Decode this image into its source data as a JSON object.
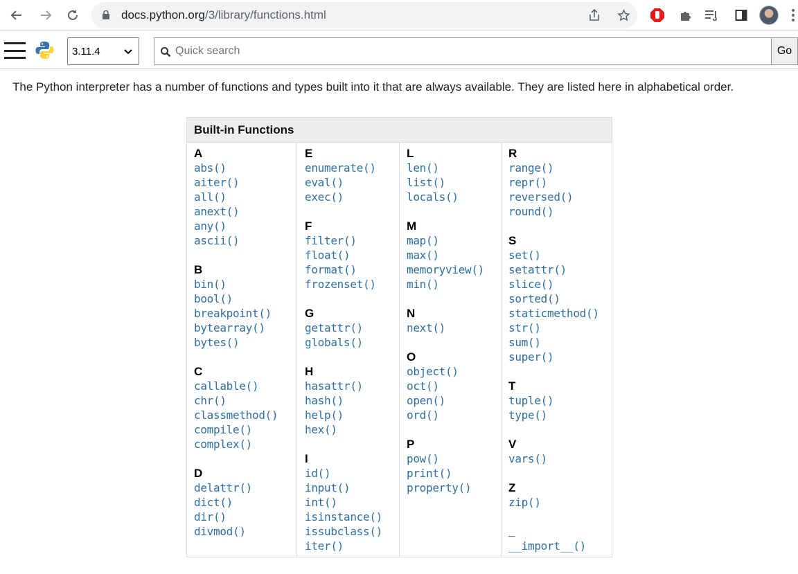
{
  "browser": {
    "url_host": "docs.python.org",
    "url_path": "/3/library/functions.html"
  },
  "docs_nav": {
    "version": "3.11.4",
    "search_placeholder": "Quick search",
    "go_label": "Go"
  },
  "intro": "The Python interpreter has a number of functions and types built into it that are always available. They are listed here in alphabetical order.",
  "table": {
    "header": "Built-in Functions",
    "columns": [
      [
        {
          "letter": "A",
          "items": [
            "abs()",
            "aiter()",
            "all()",
            "anext()",
            "any()",
            "ascii()"
          ]
        },
        {
          "letter": "B",
          "items": [
            "bin()",
            "bool()",
            "breakpoint()",
            "bytearray()",
            "bytes()"
          ]
        },
        {
          "letter": "C",
          "items": [
            "callable()",
            "chr()",
            "classmethod()",
            "compile()",
            "complex()"
          ]
        },
        {
          "letter": "D",
          "items": [
            "delattr()",
            "dict()",
            "dir()",
            "divmod()"
          ]
        }
      ],
      [
        {
          "letter": "E",
          "items": [
            "enumerate()",
            "eval()",
            "exec()"
          ]
        },
        {
          "letter": "F",
          "items": [
            "filter()",
            "float()",
            "format()",
            "frozenset()"
          ]
        },
        {
          "letter": "G",
          "items": [
            "getattr()",
            "globals()"
          ]
        },
        {
          "letter": "H",
          "items": [
            "hasattr()",
            "hash()",
            "help()",
            "hex()"
          ]
        },
        {
          "letter": "I",
          "items": [
            "id()",
            "input()",
            "int()",
            "isinstance()",
            "issubclass()",
            "iter()"
          ]
        }
      ],
      [
        {
          "letter": "L",
          "items": [
            "len()",
            "list()",
            "locals()"
          ]
        },
        {
          "letter": "M",
          "items": [
            "map()",
            "max()",
            "memoryview()",
            "min()"
          ]
        },
        {
          "letter": "N",
          "items": [
            "next()"
          ]
        },
        {
          "letter": "O",
          "items": [
            "object()",
            "oct()",
            "open()",
            "ord()"
          ]
        },
        {
          "letter": "P",
          "items": [
            "pow()",
            "print()",
            "property()"
          ]
        }
      ],
      [
        {
          "letter": "R",
          "items": [
            "range()",
            "repr()",
            "reversed()",
            "round()"
          ]
        },
        {
          "letter": "S",
          "items": [
            "set()",
            "setattr()",
            "slice()",
            "sorted()",
            "staticmethod()",
            "str()",
            "sum()",
            "super()"
          ]
        },
        {
          "letter": "T",
          "items": [
            "tuple()",
            "type()"
          ]
        },
        {
          "letter": "V",
          "items": [
            "vars()"
          ]
        },
        {
          "letter": "Z",
          "items": [
            "zip()"
          ]
        },
        {
          "letter": "_",
          "items": [
            "__import__()"
          ]
        }
      ]
    ]
  }
}
